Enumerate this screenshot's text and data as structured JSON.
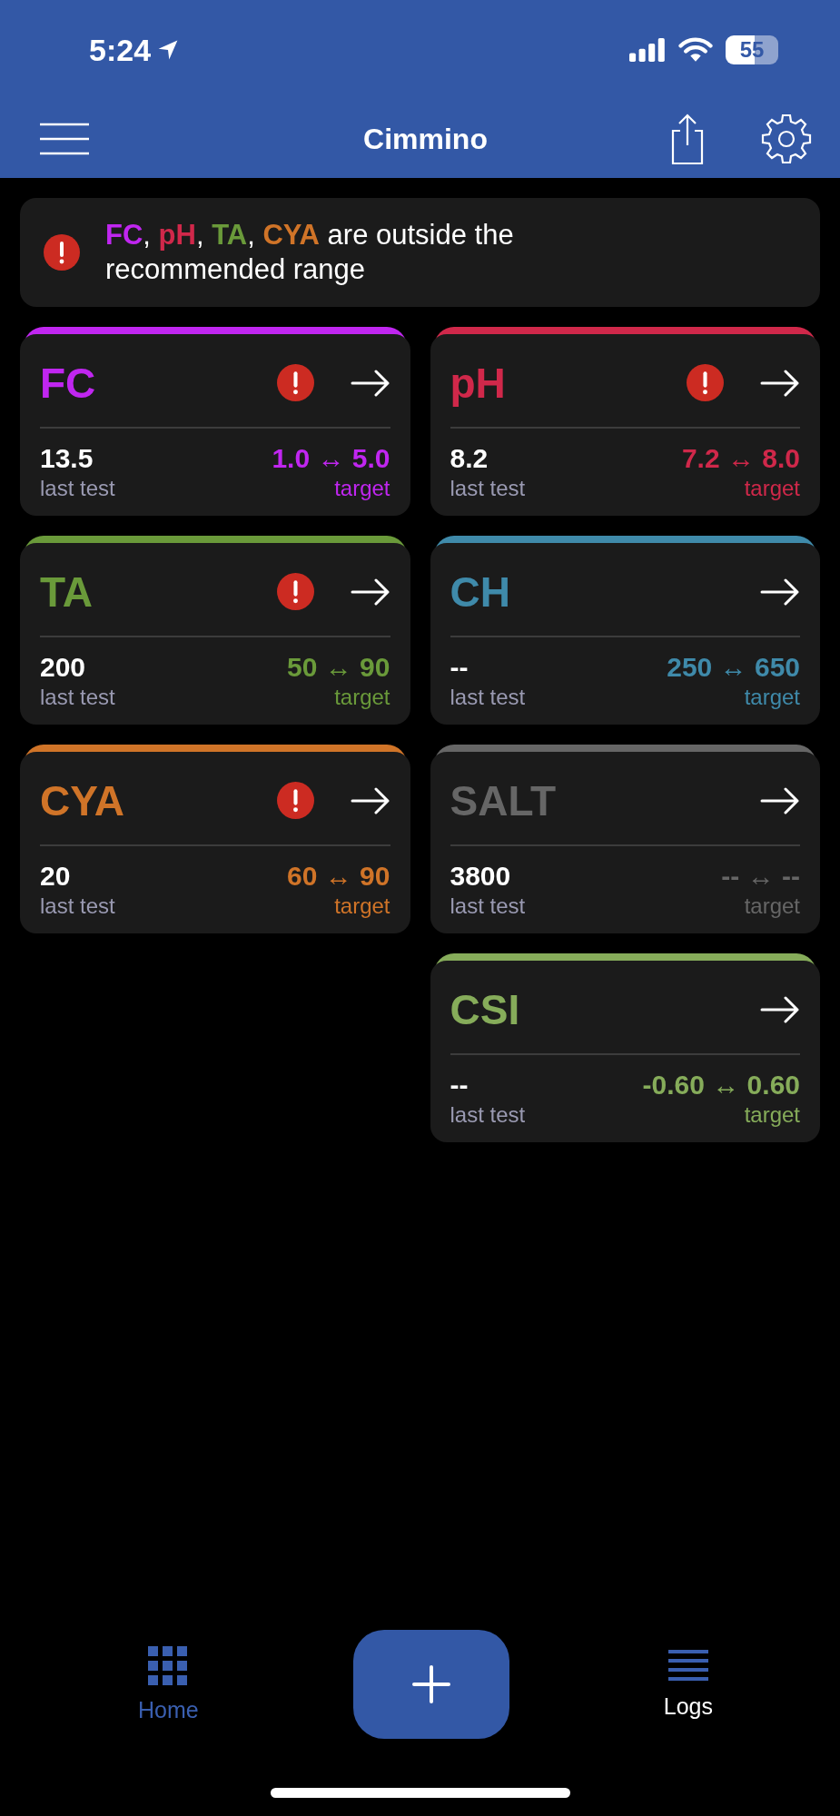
{
  "status_bar": {
    "time": "5:24",
    "battery": "55"
  },
  "nav_bar": {
    "title": "Cimmino"
  },
  "alert": {
    "segments": [
      {
        "text": "FC",
        "color": "#c026f0"
      },
      {
        "text": ", "
      },
      {
        "text": "pH",
        "color": "#d0284a"
      },
      {
        "text": ", "
      },
      {
        "text": "TA",
        "color": "#6a9a3a"
      },
      {
        "text": ", "
      },
      {
        "text": "CYA",
        "color": "#d07428"
      },
      {
        "text": " are outside the recommended range"
      }
    ]
  },
  "columns": [
    {
      "cards": [
        {
          "name": "FC",
          "color": "#c026f0",
          "alert": true,
          "value": "13.5",
          "value_label": "last test",
          "target": "1.0 ↔ 5.0",
          "target_label": "target"
        },
        {
          "name": "TA",
          "color": "#6a9a3a",
          "alert": true,
          "value": "200",
          "value_label": "last test",
          "target": "50 ↔ 90",
          "target_label": "target"
        },
        {
          "name": "CYA",
          "color": "#d07428",
          "alert": true,
          "value": "20",
          "value_label": "last test",
          "target": "60 ↔ 90",
          "target_label": "target"
        }
      ]
    },
    {
      "cards": [
        {
          "name": "pH",
          "color": "#d0284a",
          "alert": true,
          "value": "8.2",
          "value_label": "last test",
          "target": "7.2 ↔ 8.0",
          "target_label": "target"
        },
        {
          "name": "CH",
          "color": "#3f8aaa",
          "alert": false,
          "value": "--",
          "value_label": "last test",
          "target": "250 ↔ 650",
          "target_label": "target"
        },
        {
          "name": "SALT",
          "color": "#666666",
          "alert": false,
          "value": "3800",
          "value_label": "last test",
          "target": "-- ↔ --",
          "target_label": "target"
        },
        {
          "name": "CSI",
          "color": "#86ac5a",
          "alert": false,
          "value": "--",
          "value_label": "last test",
          "target": "-0.60 ↔ 0.60",
          "target_label": "target"
        }
      ]
    }
  ],
  "tab_bar": [
    {
      "label": "Home",
      "kind": "grid",
      "selected": true
    },
    {
      "kind": "add"
    },
    {
      "label": "Logs",
      "kind": "list",
      "selected": false
    }
  ]
}
